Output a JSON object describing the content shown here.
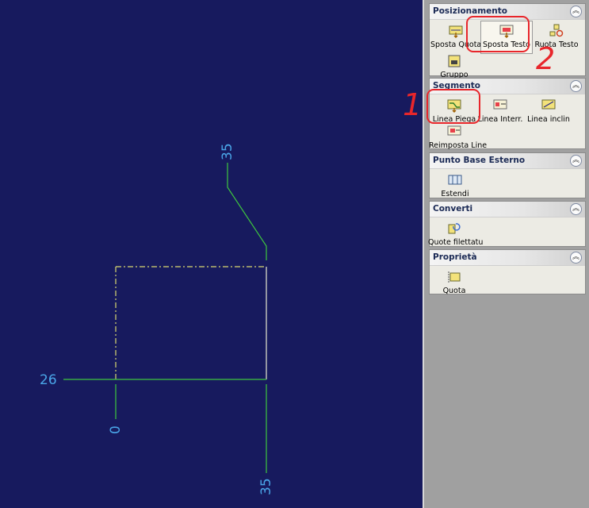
{
  "canvas": {
    "background": "#171a5e",
    "dimension_labels": {
      "top": "35",
      "left": "26",
      "bottom_left": "0",
      "bottom_right": "35"
    }
  },
  "panel": {
    "sections": [
      {
        "title": "Posizionamento",
        "tools": [
          {
            "label": "Sposta Quota",
            "icon": "move-dimension-icon"
          },
          {
            "label": "Sposta Testo",
            "icon": "move-text-icon",
            "selected": true
          },
          {
            "label": "Ruota Testo",
            "icon": "rotate-text-icon"
          },
          {
            "label": "Gruppo",
            "icon": "group-icon"
          }
        ]
      },
      {
        "title": "Segmento",
        "tools": [
          {
            "label": "Linea Piega",
            "icon": "bend-line-icon"
          },
          {
            "label": "Linea Interr.",
            "icon": "break-line-icon"
          },
          {
            "label": "Linea inclin",
            "icon": "inclined-line-icon"
          },
          {
            "label": "Reimposta Line",
            "icon": "reset-line-icon"
          }
        ]
      },
      {
        "title": "Punto Base Esterno",
        "tools": [
          {
            "label": "Estendi",
            "icon": "extend-icon"
          }
        ]
      },
      {
        "title": "Converti",
        "tools": [
          {
            "label": "Quote filettatu",
            "icon": "thread-dimension-icon"
          }
        ]
      },
      {
        "title": "Proprietà",
        "tools": [
          {
            "label": "Quota",
            "icon": "dimension-properties-icon"
          }
        ]
      }
    ]
  },
  "annotations": {
    "mark_1": "1",
    "mark_2": "2",
    "color": "#e8262b"
  }
}
